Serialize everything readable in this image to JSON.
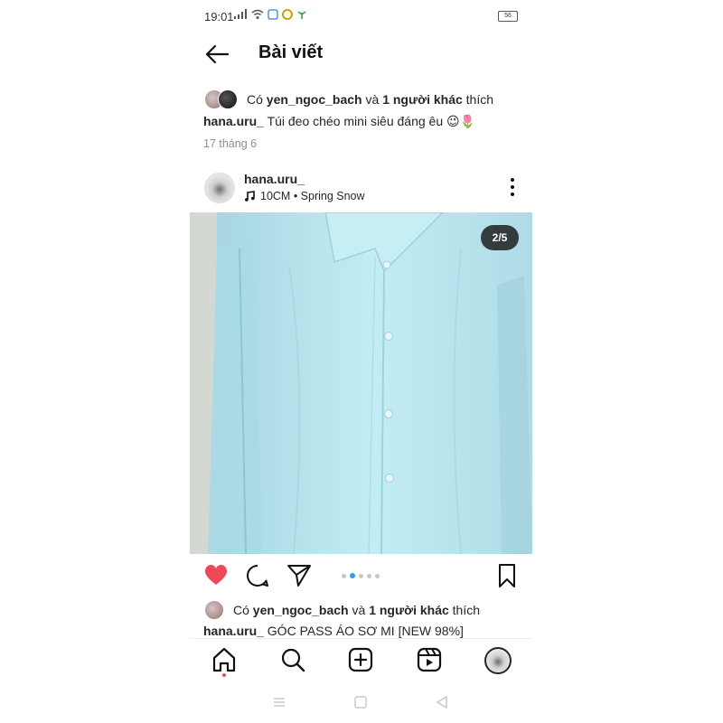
{
  "status_bar": {
    "time": "19:01",
    "battery": "56"
  },
  "header": {
    "title": "Bài viết",
    "back_icon": "arrow-left-icon"
  },
  "top_post": {
    "likes": {
      "prefix": "Có",
      "user": "yen_ngoc_bach",
      "joiner": "và",
      "others": "1 người khác",
      "suffix": "thích"
    },
    "caption": {
      "user": "hana.uru_",
      "text": "Túi đeo chéo mini siêu đáng êu 😉🌷"
    },
    "date": "17 tháng 6"
  },
  "post": {
    "username": "hana.uru_",
    "music": "10CM • Spring Snow",
    "music_icon": "music-note-icon",
    "more_icon": "more-vertical-icon",
    "image_counter": "2/5",
    "carousel": {
      "count": 5,
      "active": 1
    },
    "actions": {
      "like_icon": "heart-filled-icon",
      "comment_icon": "comment-icon",
      "share_icon": "send-icon",
      "save_icon": "bookmark-icon"
    },
    "likes": {
      "prefix": "Có",
      "user": "yen_ngoc_bach",
      "joiner": "và",
      "others": "1 người khác",
      "suffix": "thích"
    },
    "caption": {
      "user": "hana.uru_",
      "text": "GÓC PASS ÁO SƠ MI [NEW 98%]"
    }
  },
  "bottom_nav": [
    "home-icon",
    "search-icon",
    "new-post-icon",
    "reels-icon",
    "profile-avatar"
  ],
  "colors": {
    "like_red": "#ed4956",
    "active_dot": "#3897f0",
    "text": "#262626",
    "muted": "#8e8e8e"
  }
}
